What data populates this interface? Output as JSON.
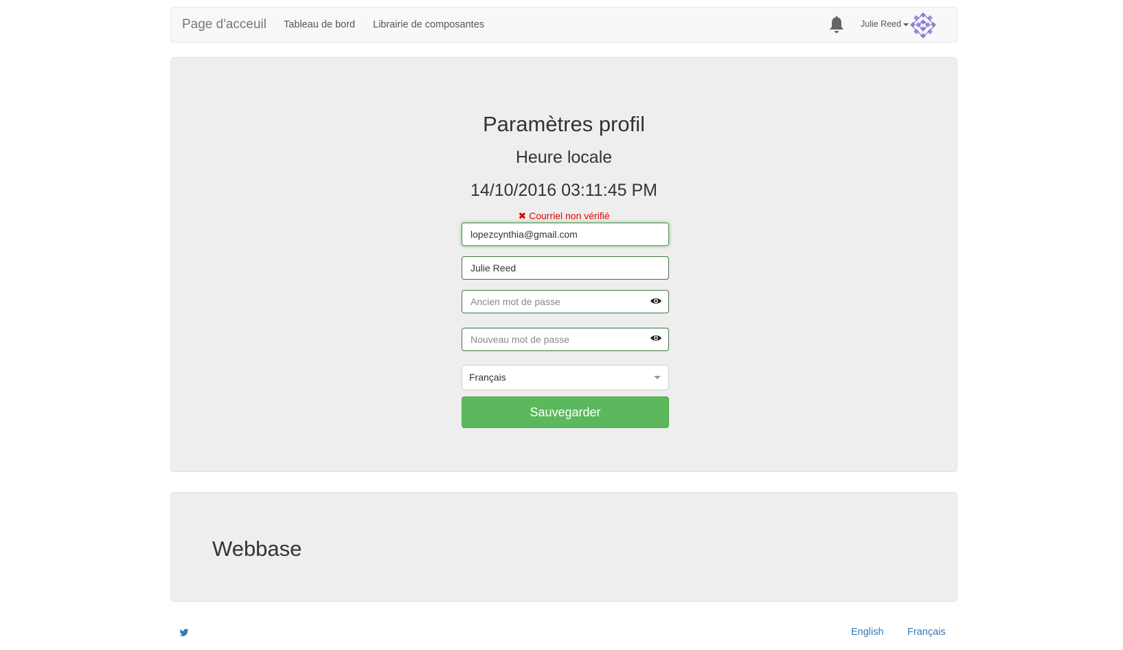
{
  "navbar": {
    "brand": "Page d'acceuil",
    "links": [
      "Tableau de bord",
      "Librairie de composantes"
    ],
    "user_name": "Julie Reed",
    "bell_icon": "bell-icon",
    "avatar_icon": "identicon-avatar"
  },
  "profile": {
    "title": "Paramètres profil",
    "subtitle": "Heure locale",
    "datetime": "14/10/2016 03:11:45 PM",
    "warning_text": "Courriel non vérifié",
    "warning_icon": "✖",
    "email_value": "lopezcynthia@gmail.com",
    "name_value": "Julie Reed",
    "old_password_placeholder": "Ancien mot de passe",
    "new_password_placeholder": "Nouveau mot de passe",
    "language_selected": "Français",
    "save_label": "Sauvegarder"
  },
  "footer": {
    "title": "Webbase",
    "twitter_icon": "twitter-icon",
    "languages": [
      "English",
      "Français"
    ]
  },
  "colors": {
    "accent_green": "#5cb85c",
    "field_border": "#3c763d",
    "warning_red": "#e00000",
    "link_blue": "#337ab7",
    "panel_bg": "#eeeeee"
  }
}
